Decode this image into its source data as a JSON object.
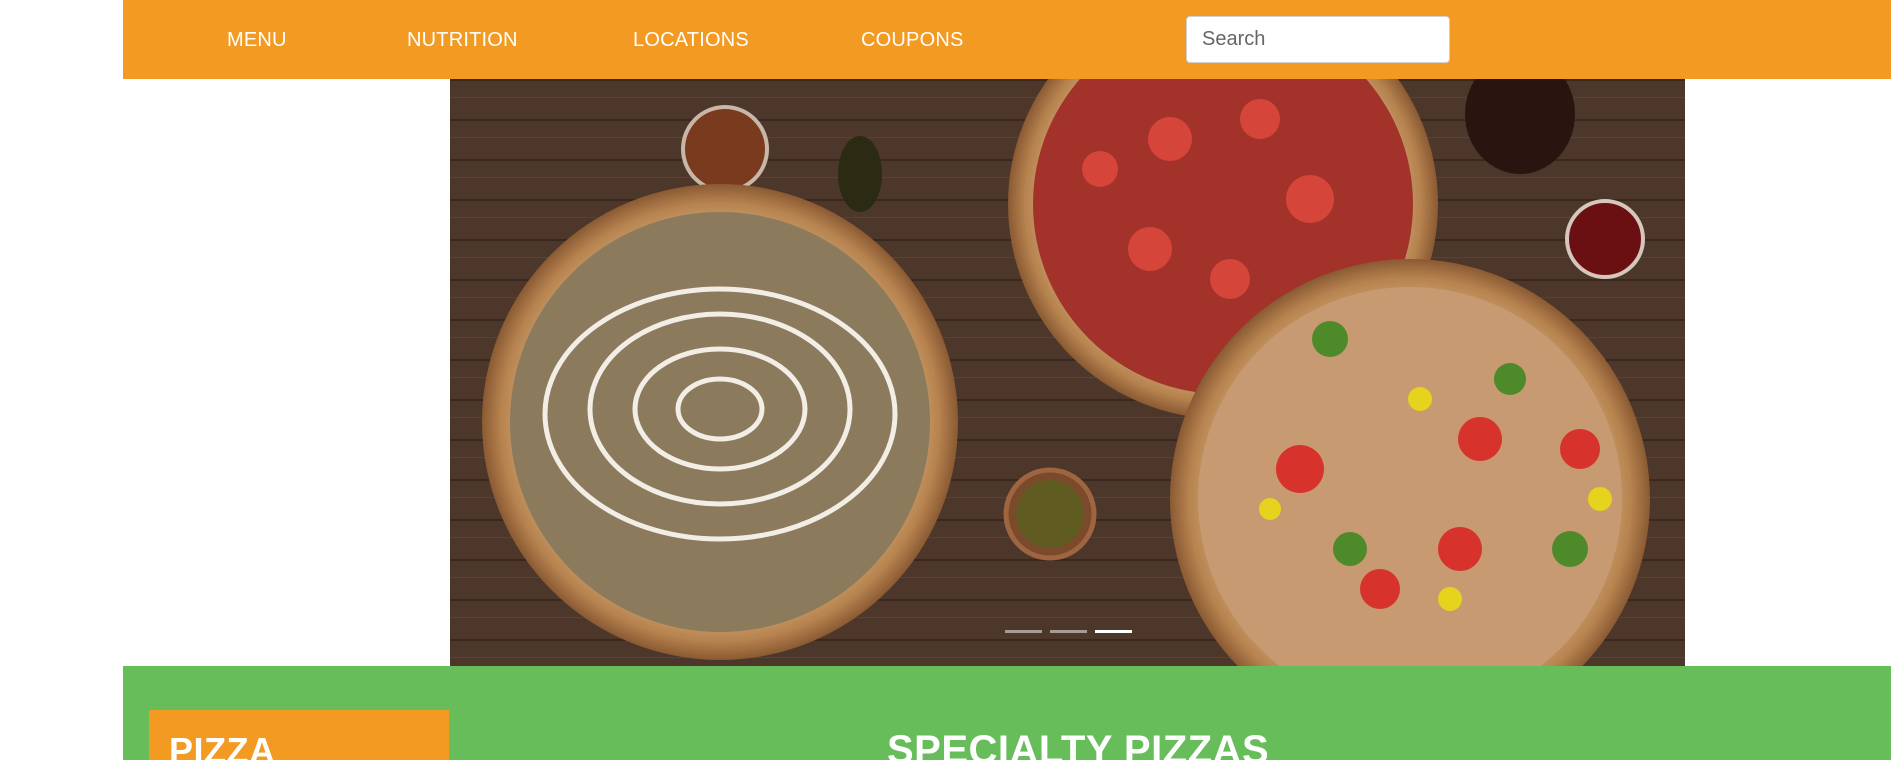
{
  "nav": {
    "items": [
      {
        "label": "MENU"
      },
      {
        "label": "NUTRITION"
      },
      {
        "label": "LOCATIONS"
      },
      {
        "label": "COUPONS"
      }
    ],
    "search_placeholder": "Search",
    "search_value": ""
  },
  "carousel": {
    "slide_count": 3,
    "active_index": 2
  },
  "sidebar": {
    "title": "PIZZA"
  },
  "main": {
    "title": "SPECIALTY PIZZAS"
  },
  "colors": {
    "brand_orange": "#f39a23",
    "brand_green": "#67bd5a",
    "text_white": "#ffffff"
  }
}
